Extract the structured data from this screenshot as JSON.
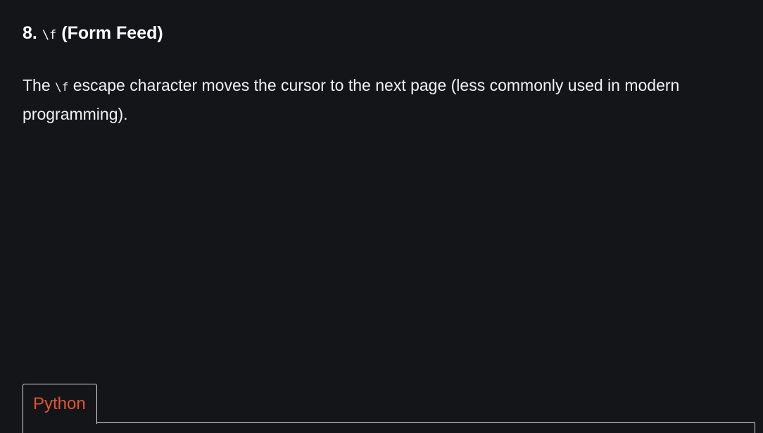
{
  "section": {
    "heading_number": "8.",
    "heading_code": "\\f",
    "heading_text": "(Form Feed)",
    "para_before": "The",
    "para_code": "\\f",
    "para_after": "escape character moves the cursor to the next page (less commonly used in modern programming)."
  },
  "code_tabs": {
    "active_tab": "Python"
  },
  "colors": {
    "background": "#141518",
    "tab_accent": "#e0552b",
    "border": "#d9d9d9"
  }
}
